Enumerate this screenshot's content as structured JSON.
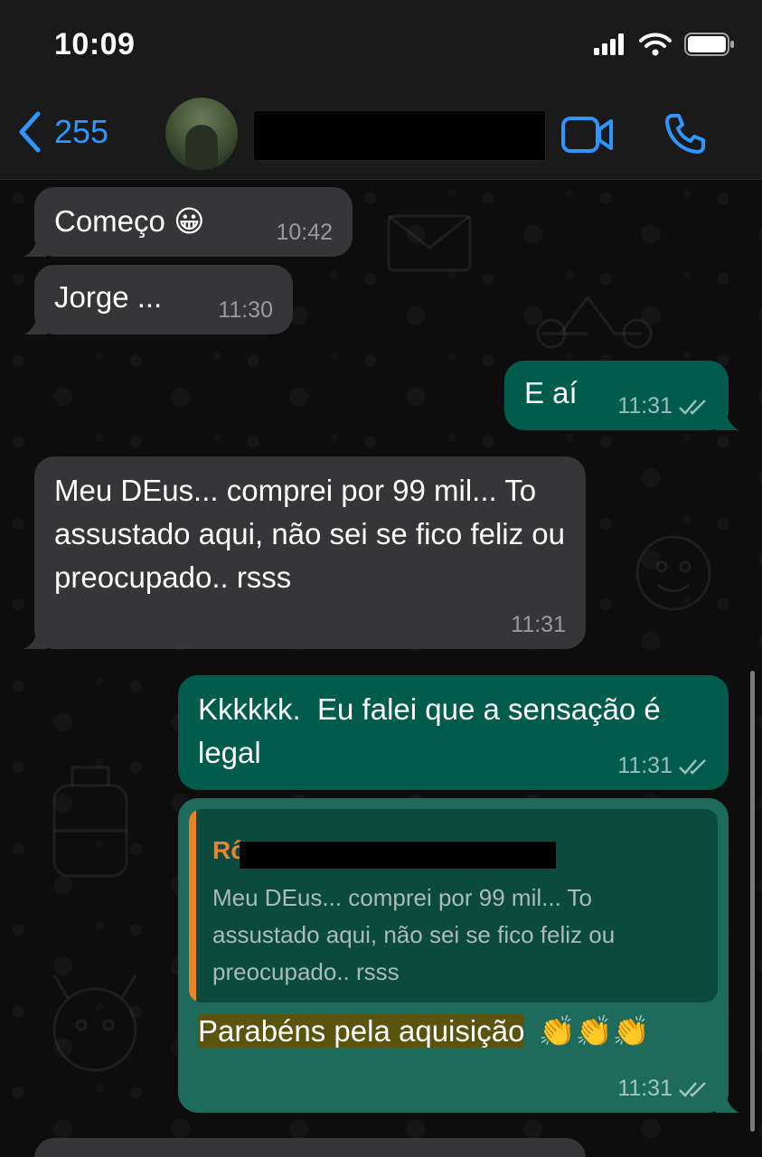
{
  "status_bar": {
    "time": "10:09"
  },
  "header": {
    "back_count": "255",
    "icons": [
      "back-chevron-icon",
      "video-call-icon",
      "phone-icon"
    ]
  },
  "messages": [
    {
      "direction": "in",
      "text": "Começo",
      "emoji": "😀",
      "time": "10:42"
    },
    {
      "direction": "in",
      "text": "Jorge ...",
      "time": "11:30"
    },
    {
      "direction": "out",
      "text": "E aí",
      "time": "11:31",
      "status": "read-double-check"
    },
    {
      "direction": "in",
      "text": "Meu DEus... comprei por 99 mil... To assustado aqui, não sei se fico feliz ou preocupado.. rsss",
      "time": "11:31"
    },
    {
      "direction": "out",
      "text": "Kkkkkk.  Eu falei que a sensação é legal",
      "time": "11:31",
      "status": "read-double-check"
    },
    {
      "direction": "out",
      "quote": {
        "author_visible": "Rô",
        "text": "Meu DEus... comprei por 99 mil... To assustado aqui, não sei se fico feliz ou preocupado.. rsss"
      },
      "text": "Parabéns pela aquisição",
      "emojis": "👏👏👏",
      "time": "11:31",
      "status": "read-double-check"
    }
  ],
  "colors": {
    "incoming_bubble": "#363638",
    "outgoing_bubble": "#015c4b",
    "accent_blue": "#2f96ff",
    "quote_bar": "#e9842b",
    "highlight": "#5a5410"
  }
}
